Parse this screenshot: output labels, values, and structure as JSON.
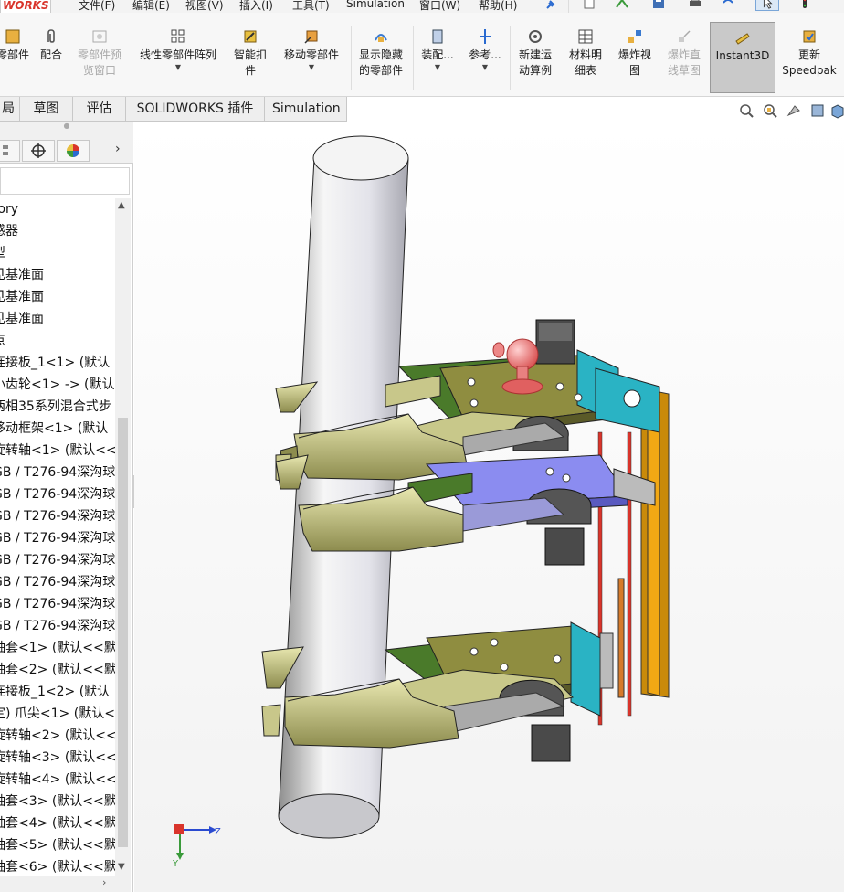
{
  "menubar": {
    "logo": "WORKS",
    "items": [
      "文件(F)",
      "编辑(E)",
      "视图(V)",
      "插入(I)",
      "工具(T)",
      "Simulation",
      "窗口(W)",
      "帮助(H)"
    ]
  },
  "ribbon": {
    "buttons": [
      {
        "label1": "零部件",
        "label2": ""
      },
      {
        "label1": "配合",
        "label2": ""
      },
      {
        "label1": "零部件预",
        "label2": "览窗口"
      },
      {
        "label1": "线性零部件阵列",
        "label2": ""
      },
      {
        "label1": "智能扣",
        "label2": "件"
      },
      {
        "label1": "移动零部件",
        "label2": ""
      },
      {
        "label1": "显示隐藏",
        "label2": "的零部件"
      },
      {
        "label1": "装配...",
        "label2": ""
      },
      {
        "label1": "参考...",
        "label2": ""
      },
      {
        "label1": "新建运",
        "label2": "动算例"
      },
      {
        "label1": "材料明",
        "label2": "细表"
      },
      {
        "label1": "爆炸视",
        "label2": "图"
      },
      {
        "label1": "爆炸直",
        "label2": "线草图"
      },
      {
        "label1": "Instant3D",
        "label2": ""
      },
      {
        "label1": "更新",
        "label2": "Speedpak"
      }
    ]
  },
  "tabs": [
    "局",
    "草图",
    "评估",
    "SOLIDWORKS 插件",
    "Simulation"
  ],
  "tree": {
    "nodes": [
      "tory",
      "感器",
      "型",
      "见基准面",
      "见基准面",
      "见基准面",
      "点",
      "连接板_1<1> (默认",
      "小齿轮<1> -> (默认",
      "两相35系列混合式步",
      "移动框架<1> (默认",
      "旋转轴<1> (默认<<",
      "GB / T276-94深沟球",
      "GB / T276-94深沟球",
      "GB / T276-94深沟球",
      "GB / T276-94深沟球",
      "GB / T276-94深沟球",
      "GB / T276-94深沟球",
      "GB / T276-94深沟球",
      "GB / T276-94深沟球",
      "轴套<1> (默认<<默",
      "轴套<2> (默认<<默",
      "连接板_1<2> (默认",
      "定) 爪尖<1> (默认<",
      "旋转轴<2> (默认<<",
      "旋转轴<3> (默认<<",
      "旋转轴<4> (默认<<",
      "轴套<3> (默认<<默",
      "轴套<4> (默认<<默",
      "轴套<5> (默认<<默",
      "轴套<6> (默认<<默"
    ]
  },
  "triad": {
    "z": "Z",
    "y": "Y"
  },
  "colors": {
    "accent": "#d9342b",
    "plate": "#8a8a3a",
    "arm": "#c8c78a",
    "frame": "#e8a011",
    "blue": "#8b8cf0",
    "teal": "#2ab3c4",
    "red": "#d9342b"
  }
}
